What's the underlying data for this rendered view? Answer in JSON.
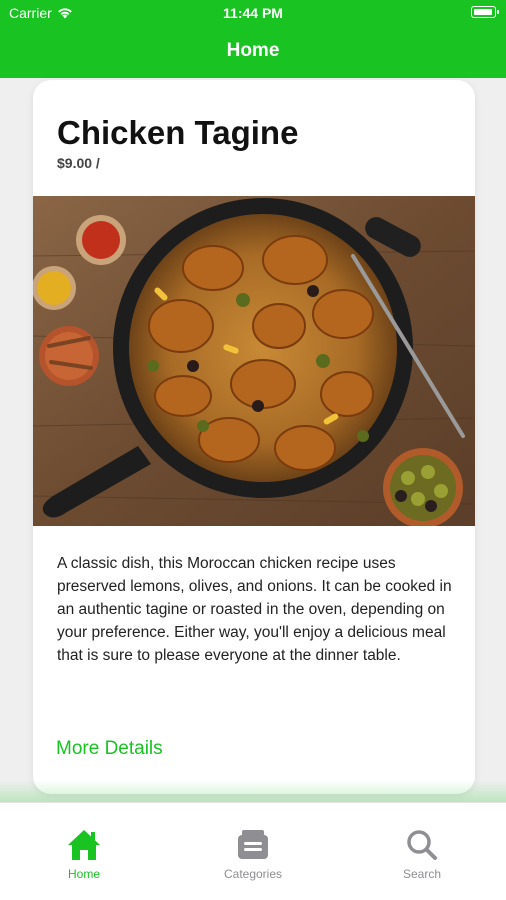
{
  "status_bar": {
    "carrier": "Carrier",
    "time": "11:44 PM"
  },
  "nav": {
    "title": "Home"
  },
  "card": {
    "title": "Chicken Tagine",
    "price": "$9.00 /",
    "description": "A classic dish, this Moroccan chicken recipe uses preserved lemons, olives, and onions. It can be cooked in an authentic tagine or roasted in the oven, depending on your preference. Either way, you'll enjoy a delicious meal that is sure to please everyone at the dinner table.",
    "more_details": "More Details"
  },
  "tabs": [
    {
      "label": "Home",
      "icon": "home-icon",
      "active": true
    },
    {
      "label": "Categories",
      "icon": "categories-icon",
      "active": false
    },
    {
      "label": "Search",
      "icon": "search-icon",
      "active": false
    }
  ],
  "colors": {
    "accent": "#19c322",
    "inactive": "#8e8e93",
    "background": "#efefef"
  }
}
